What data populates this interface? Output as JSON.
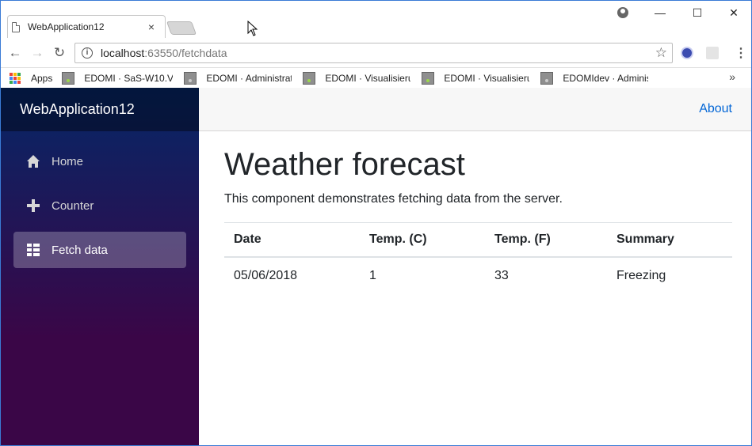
{
  "browser": {
    "tab_title": "WebApplication12",
    "tab_close": "×",
    "url_host": "localhost",
    "url_rest": ":63550/fetchdata",
    "info_glyph": "i",
    "star_glyph": "☆",
    "menu_glyph": "⋮",
    "bookmarks_more": "»",
    "controls": {
      "minimize": "—",
      "maximize": "☐",
      "close": "✕"
    },
    "nav": {
      "back": "←",
      "forward": "→",
      "reload": "↻"
    },
    "bookmarks": [
      {
        "label": "Apps"
      },
      {
        "label": "EDOMI · SaS-W10.Vi"
      },
      {
        "label": "EDOMI · Administrat"
      },
      {
        "label": "EDOMI · Visualisierun"
      },
      {
        "label": "EDOMI · Visualisierun"
      },
      {
        "label": "EDOMIdev · Adminis"
      }
    ]
  },
  "app": {
    "brand": "WebApplication12",
    "nav": [
      {
        "label": "Home",
        "icon": "home-icon"
      },
      {
        "label": "Counter",
        "icon": "plus-icon"
      },
      {
        "label": "Fetch data",
        "icon": "list-icon",
        "active": true
      }
    ],
    "about": "About",
    "page_title": "Weather forecast",
    "page_description": "This component demonstrates fetching data from the server.",
    "table": {
      "headers": [
        "Date",
        "Temp. (C)",
        "Temp. (F)",
        "Summary"
      ],
      "rows": [
        [
          "05/06/2018",
          "1",
          "33",
          "Freezing"
        ]
      ]
    }
  },
  "colors": {
    "link": "#0366d6",
    "sidebar_top": "#052767",
    "sidebar_bottom": "#3a0647"
  }
}
